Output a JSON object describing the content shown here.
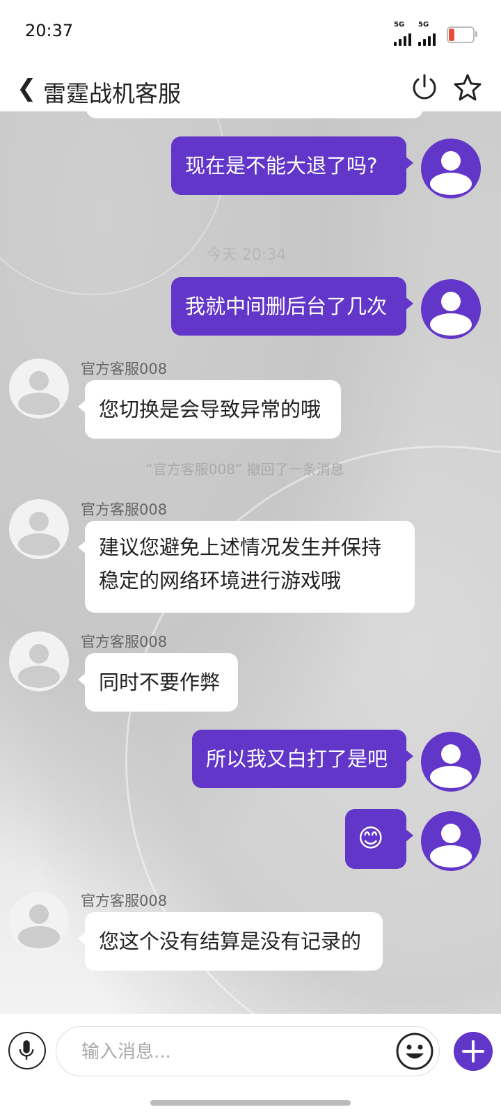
{
  "status_bar": {
    "time": "20:37",
    "network_1": "5G",
    "network_2": "5G"
  },
  "header": {
    "title": "雷霆战机客服"
  },
  "messages": [
    {
      "type": "outgoing",
      "text": "现在是不能大退了吗?"
    },
    {
      "type": "timestamp",
      "text": "今天 20:34"
    },
    {
      "type": "outgoing",
      "text": "我就中间删后台了几次"
    },
    {
      "type": "incoming",
      "sender": "官方客服008",
      "text": "您切换是会导致异常的哦"
    },
    {
      "type": "system",
      "text": "“官方客服008” 撤回了一条消息"
    },
    {
      "type": "incoming",
      "sender": "官方客服008",
      "text_line1": "建议您避免上述情况发生并保持",
      "text_line2": "稳定的网络环境进行游戏哦"
    },
    {
      "type": "incoming",
      "sender": "官方客服008",
      "text": "同时不要作弊"
    },
    {
      "type": "outgoing",
      "text": "所以我又白打了是吧"
    },
    {
      "type": "outgoing",
      "text": "😊"
    },
    {
      "type": "incoming",
      "sender": "官方客服008",
      "text": "您这个没有结算是没有记录的"
    }
  ],
  "input": {
    "placeholder": "输入消息..."
  },
  "colors": {
    "accent": "#6136c8",
    "incoming_bubble": "#ffffff",
    "battery_low": "#e74c3c"
  },
  "icons": [
    "back-icon",
    "power-icon",
    "star-icon",
    "microphone-icon",
    "emoji-icon",
    "plus-icon",
    "avatar-icon"
  ]
}
